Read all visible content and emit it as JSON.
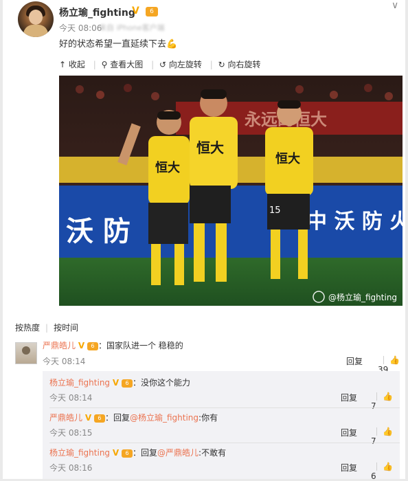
{
  "post": {
    "username": "杨立瑜_fighting",
    "verified_mark": "V",
    "level_badge": "6",
    "time": "今天 08:06",
    "source": "来自 iPhone客户端",
    "content": "好的状态希望一直延续下去",
    "content_emoji": "💪"
  },
  "toolbar": {
    "collapse": "收起",
    "view_large": "查看大图",
    "rotate_left": "向左旋转",
    "rotate_right": "向右旋转"
  },
  "photo": {
    "watermark": "@杨立瑜_fighting",
    "banner_text": "永远的恒大",
    "ad_text_1": "沃  防",
    "ad_text_2": "中 沃 防 火",
    "jersey_text": "恒大",
    "jersey_number": "15"
  },
  "comment_tabs": {
    "hot": "按热度",
    "time": "按时间"
  },
  "comments": [
    {
      "user": "严鼎皓儿",
      "sep": "：",
      "text": "国家队进一个 稳稳的",
      "time": "今天 08:14",
      "reply_label": "回复",
      "likes": "39"
    }
  ],
  "sub_comments": [
    {
      "user": "杨立瑜_fighting",
      "prefix": "：",
      "mention": "",
      "text": "没你这个能力",
      "time": "今天 08:14",
      "reply_label": "回复",
      "likes": "7"
    },
    {
      "user": "严鼎皓儿",
      "prefix": "：回复",
      "mention": "@杨立瑜_fighting",
      "text": ":你有",
      "time": "今天 08:15",
      "reply_label": "回复",
      "likes": "7"
    },
    {
      "user": "杨立瑜_fighting",
      "prefix": "：回复",
      "mention": "@严鼎皓儿",
      "text": ":不敢有",
      "time": "今天 08:16",
      "reply_label": "回复",
      "likes": "6"
    }
  ],
  "colors": {
    "username_link": "#eb7350",
    "vip_badge": "#f7a800",
    "sub_bg": "#f2f2f5"
  }
}
